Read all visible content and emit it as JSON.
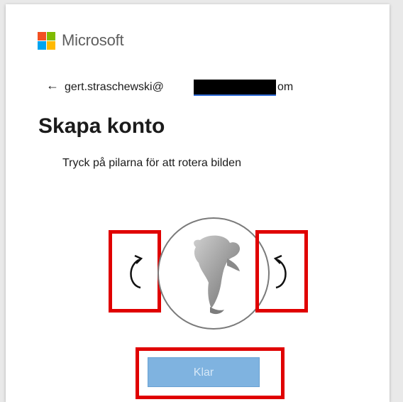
{
  "brand": {
    "name": "Microsoft",
    "colors": [
      "#f25022",
      "#7fba00",
      "#00a4ef",
      "#ffb900"
    ]
  },
  "identity": {
    "back_icon": "back-arrow-icon",
    "back_glyph": "←",
    "email_prefix": "gert.straschewski@",
    "email_suffix": "om"
  },
  "title": "Skapa konto",
  "instruction": "Tryck på pilarna för att rotera bilden",
  "controls": {
    "rotate_left_icon": "rotate-counterclockwise-icon",
    "rotate_right_icon": "rotate-clockwise-icon"
  },
  "done_label": "Klar",
  "colors": {
    "highlight": "#e00000",
    "button_disabled": "#7fb3e0"
  }
}
